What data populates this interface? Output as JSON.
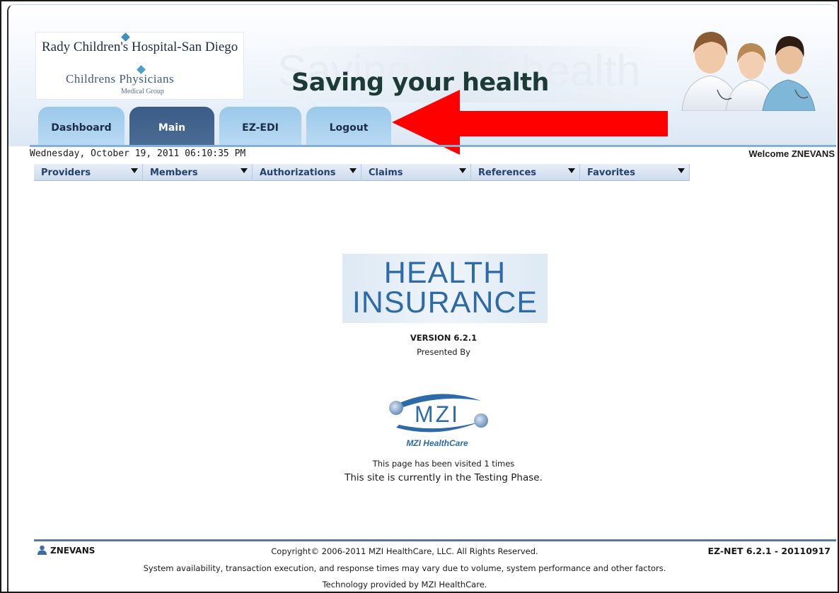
{
  "header": {
    "logo": {
      "line1": "Rady Children's Hospital-San Diego",
      "line2": "Childrens Physicians",
      "line3": "Medical Group"
    },
    "slogan": "Saving your health",
    "slogan_ghost": "Saving your health"
  },
  "tabs": [
    {
      "label": "Dashboard",
      "style": "light"
    },
    {
      "label": "Main",
      "style": "dark",
      "selected": true
    },
    {
      "label": "EZ-EDI",
      "style": "light"
    },
    {
      "label": "Logout",
      "style": "light"
    }
  ],
  "annotation": {
    "arrow_color": "#ff0000",
    "arrow_points_to": "Logout"
  },
  "status_bar": {
    "datetime": "Wednesday, October 19, 2011 06:10:35 PM",
    "welcome": "Welcome ZNEVANS"
  },
  "menu": [
    {
      "label": "Providers"
    },
    {
      "label": "Members"
    },
    {
      "label": "Authorizations"
    },
    {
      "label": "Claims"
    },
    {
      "label": "References"
    },
    {
      "label": "Favorites"
    }
  ],
  "main": {
    "product_line1": "HEALTH",
    "product_line2": "INSURANCE",
    "version": "VERSION 6.2.1",
    "presented_by": "Presented By",
    "vendor_logo_text": "MZI",
    "vendor_caption": "MZI HealthCare",
    "visits": "This page has been visited 1 times",
    "phase": "This site is currently in the Testing Phase."
  },
  "footer": {
    "user": "ZNEVANS",
    "copyright": "Copyright© 2006-2011 MZI HealthCare, LLC. All Rights Reserved.",
    "build": "EZ-NET 6.2.1 - 20110917",
    "disclaimer": "System availability, transaction execution, and response times may vary due to volume, system performance and other factors.",
    "technology": "Technology provided by MZI HealthCare."
  },
  "colors": {
    "accent_blue": "#2d6aa7",
    "tab_dark": "#3a5c86",
    "tab_light": "#9bc8ea",
    "menu_text": "#23406e"
  },
  "icons": [
    "user-icon",
    "dropdown-caret-icon",
    "red-arrow-annotation",
    "mzi-globe-icon"
  ]
}
